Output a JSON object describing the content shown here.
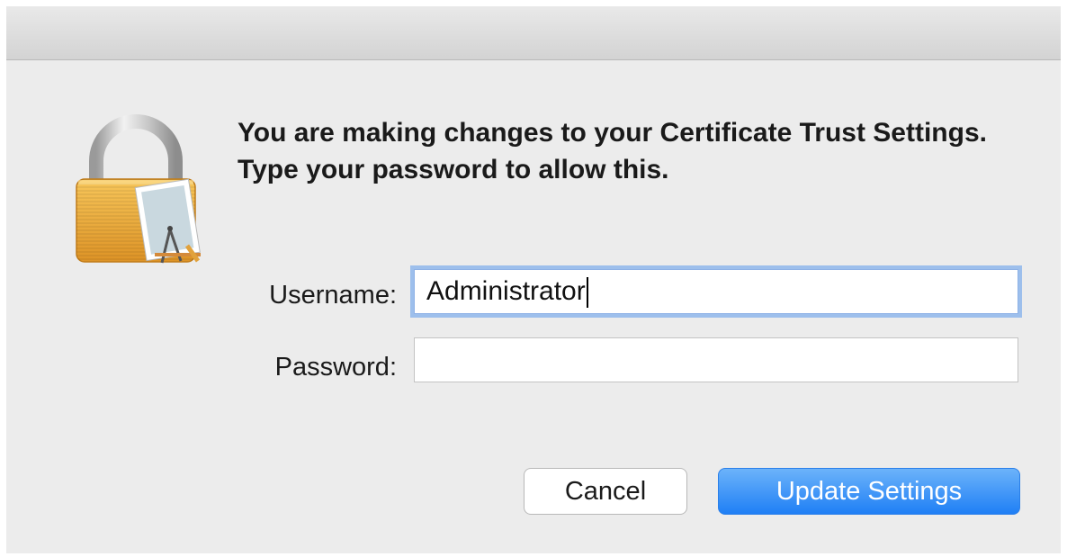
{
  "dialog": {
    "message": "You are making changes to your Certificate Trust Settings. Type your password to allow this.",
    "icon": "lock-certificate-icon",
    "fields": {
      "username_label": "Username:",
      "username_value": "Administrator",
      "password_label": "Password:",
      "password_value": ""
    },
    "buttons": {
      "cancel": "Cancel",
      "confirm": "Update Settings"
    }
  },
  "colors": {
    "dialog_background": "#ececec",
    "focus_ring": "#9dbfec",
    "primary_button": "#1f7ff5",
    "lock_body": "#f2b34a"
  }
}
